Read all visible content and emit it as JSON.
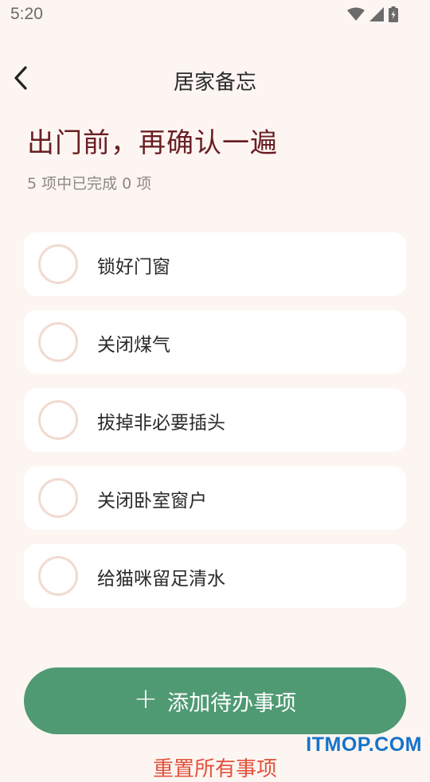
{
  "status_bar": {
    "time": "5:20",
    "icons": [
      "wifi-icon",
      "signal-icon",
      "battery-charging-icon"
    ]
  },
  "app_bar": {
    "back_icon": "chevron-left-icon",
    "title": "居家备忘"
  },
  "header": {
    "headline": "出门前，再确认一遍",
    "progress": "5 项中已完成 0 项"
  },
  "tasks": [
    {
      "label": "锁好门窗",
      "done": false
    },
    {
      "label": "关闭煤气",
      "done": false
    },
    {
      "label": "拔掉非必要插头",
      "done": false
    },
    {
      "label": "关闭卧室窗户",
      "done": false
    },
    {
      "label": "给猫咪留足清水",
      "done": false
    }
  ],
  "actions": {
    "add_plus": "+",
    "add_label": "添加待办事项",
    "reset_label": "重置所有事项"
  },
  "watermark": "ITMOP.COM",
  "colors": {
    "background": "#fdf5f1",
    "accent_green": "#4f9a73",
    "headline": "#6a1f24",
    "reset_red": "#e0533d",
    "check_ring": "#f1dad1"
  }
}
